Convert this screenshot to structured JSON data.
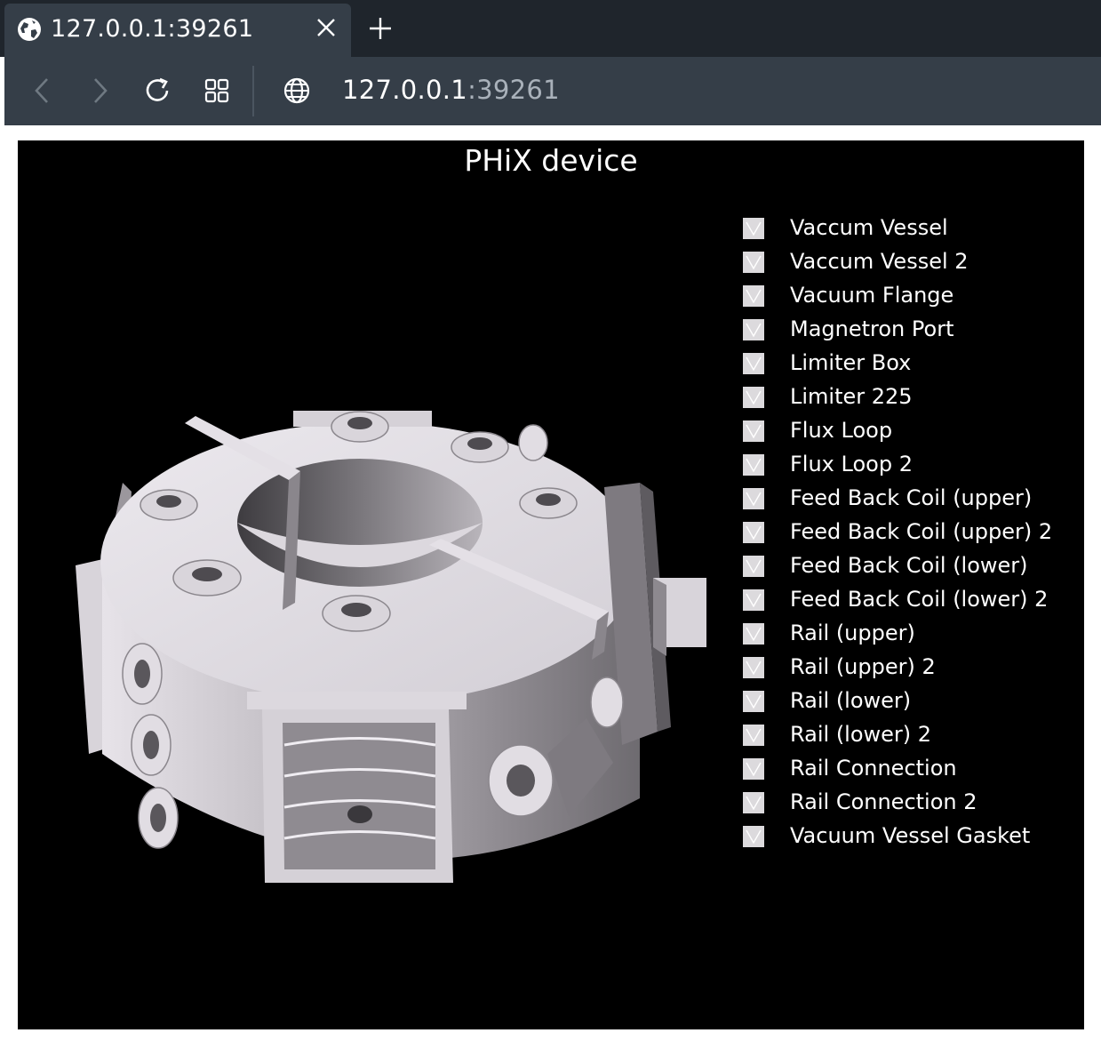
{
  "browser": {
    "tab_title": "127.0.0.1:39261",
    "url_host": "127.0.0.1",
    "url_port": ":39261"
  },
  "viewer": {
    "title": "PHiX device",
    "legend": [
      {
        "label": "Vaccum Vessel",
        "checked": true
      },
      {
        "label": "Vaccum Vessel 2",
        "checked": true
      },
      {
        "label": "Vacuum Flange",
        "checked": true
      },
      {
        "label": "Magnetron Port",
        "checked": true
      },
      {
        "label": "Limiter Box",
        "checked": true
      },
      {
        "label": "Limiter 225",
        "checked": true
      },
      {
        "label": "Flux Loop",
        "checked": true
      },
      {
        "label": "Flux Loop 2",
        "checked": true
      },
      {
        "label": "Feed Back Coil (upper)",
        "checked": true
      },
      {
        "label": "Feed Back Coil (upper) 2",
        "checked": true
      },
      {
        "label": "Feed Back Coil (lower)",
        "checked": true
      },
      {
        "label": "Feed Back Coil (lower) 2",
        "checked": true
      },
      {
        "label": "Rail (upper)",
        "checked": true
      },
      {
        "label": "Rail (upper) 2",
        "checked": true
      },
      {
        "label": "Rail (lower)",
        "checked": true
      },
      {
        "label": "Rail (lower) 2",
        "checked": true
      },
      {
        "label": "Rail Connection",
        "checked": true
      },
      {
        "label": "Rail Connection 2",
        "checked": true
      },
      {
        "label": "Vacuum Vessel Gasket",
        "checked": true
      }
    ]
  },
  "colors": {
    "chrome_dark": "#1f252c",
    "chrome": "#353e48",
    "viewer_bg": "#000000",
    "model_light": "#dcd8de",
    "model_dark": "#6e6b70"
  }
}
